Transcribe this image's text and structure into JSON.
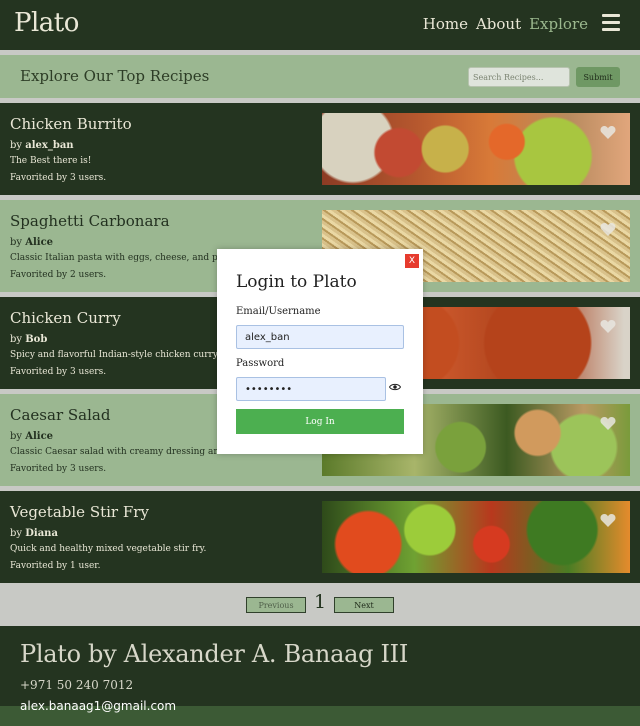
{
  "header": {
    "brand": "Plato",
    "nav": [
      "Home",
      "About",
      "Explore"
    ],
    "active": "Explore"
  },
  "search": {
    "heading": "Explore Our Top Recipes",
    "placeholder": "Search Recipes...",
    "submit_label": "Submit"
  },
  "recipes": [
    {
      "title": "Chicken Burrito",
      "by": "by ",
      "author": "alex_ban",
      "description": "The Best there is!",
      "favorited": "Favorited by 3 users."
    },
    {
      "title": "Spaghetti Carbonara",
      "by": "by ",
      "author": "Alice",
      "description": "Classic Italian pasta with eggs, cheese, and pancetta.",
      "favorited": "Favorited by 2 users."
    },
    {
      "title": "Chicken Curry",
      "by": "by ",
      "author": "Bob",
      "description": "Spicy and flavorful Indian-style chicken curry.",
      "favorited": "Favorited by 3 users."
    },
    {
      "title": "Caesar Salad",
      "by": "by ",
      "author": "Alice",
      "description": "Classic Caesar salad with creamy dressing and croutons.",
      "favorited": "Favorited by 3 users."
    },
    {
      "title": "Vegetable Stir Fry",
      "by": "by ",
      "author": "Diana",
      "description": "Quick and healthy mixed vegetable stir fry.",
      "favorited": "Favorited by 1 user."
    }
  ],
  "pagination": {
    "previous_label": "Previous",
    "page": "1",
    "next_label": "Next"
  },
  "footer": {
    "title": "Plato by Alexander A. Banaag III",
    "phone": "+971 50 240 7012",
    "email": "alex.banaag1@gmail.com"
  },
  "login": {
    "title": "Login to Plato",
    "close_label": "X",
    "email_label": "Email/Username",
    "email_value": "alex_ban",
    "password_label": "Password",
    "password_value": "password",
    "submit_label": "Log In"
  },
  "colors": {
    "dark_green": "#243420",
    "light_green": "#9bb791",
    "accent": "#4caf50",
    "close": "#e63b2e"
  }
}
